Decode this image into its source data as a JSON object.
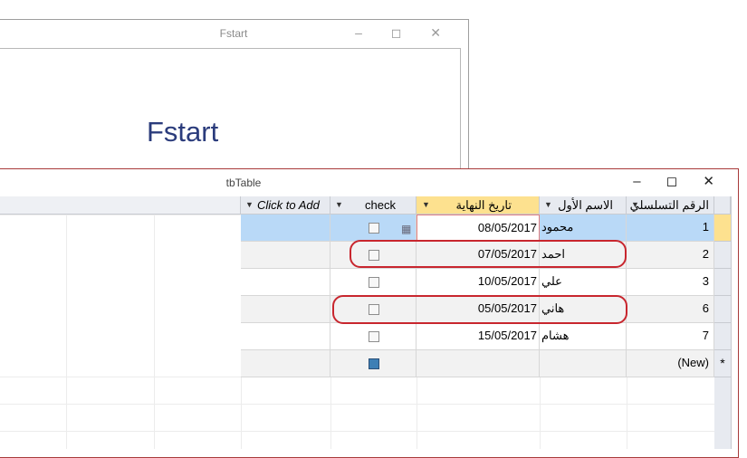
{
  "fstart_window": {
    "title": "Fstart",
    "heading": "Fstart",
    "controls": "– ◻ ✕"
  },
  "tb_window": {
    "title": "tbTable",
    "controls": "– ◻ ✕"
  },
  "columns": {
    "serial": "الرقم التسلسلي",
    "first_name": "الاسم الأول",
    "end_date": "تاريخ النهاية",
    "check": "check",
    "click_to_add": "Click to Add"
  },
  "rows": [
    {
      "serial": "1",
      "name": "محمود",
      "date": "08/05/2017"
    },
    {
      "serial": "2",
      "name": "احمد",
      "date": "07/05/2017"
    },
    {
      "serial": "3",
      "name": "علي",
      "date": "10/05/2017"
    },
    {
      "serial": "6",
      "name": "هاني",
      "date": "05/05/2017"
    },
    {
      "serial": "7",
      "name": "هشام",
      "date": "15/05/2017"
    }
  ],
  "new_row": {
    "label": "(New)",
    "marker": "*"
  },
  "colors": {
    "selected_header": "#fde18f",
    "selected_row": "#b9d9f7",
    "annotation": "#c8262e",
    "heading": "#2b3c7c"
  }
}
